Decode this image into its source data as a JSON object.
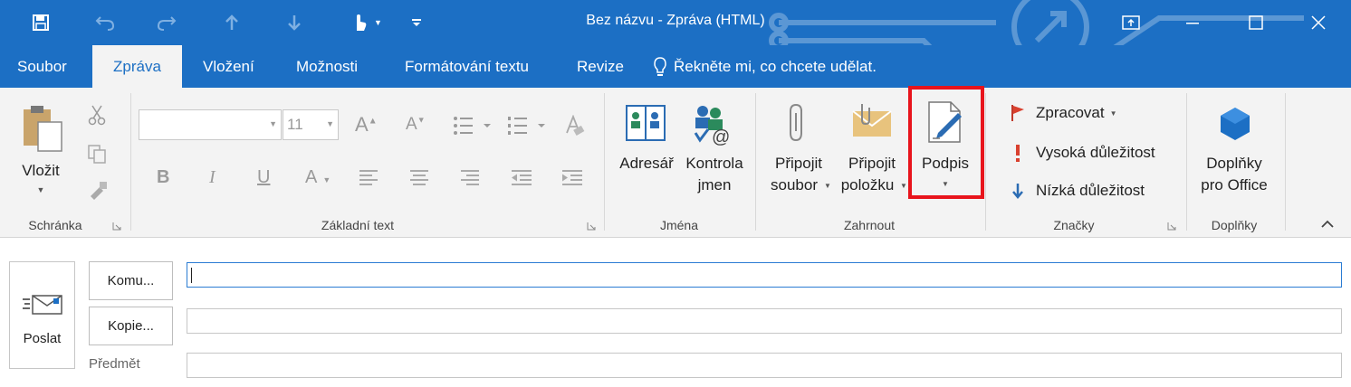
{
  "window": {
    "title": "Bez názvu  -  Zpráva (HTML)"
  },
  "tabs": [
    "Soubor",
    "Zpráva",
    "Vložení",
    "Možnosti",
    "Formátování textu",
    "Revize"
  ],
  "active_tab": "Zpráva",
  "tell_me": "Řekněte mi, co chcete udělat.",
  "ribbon": {
    "clipboard": {
      "paste_label": "Vložit",
      "group_label": "Schránka"
    },
    "basic_text": {
      "font_size": "11",
      "group_label": "Základní text"
    },
    "names": {
      "address_book": "Adresář",
      "check_names_1": "Kontrola",
      "check_names_2": "jmen",
      "group_label": "Jména"
    },
    "include": {
      "attach_file_1": "Připojit",
      "attach_file_2": "soubor",
      "attach_item_1": "Připojit",
      "attach_item_2": "položku",
      "signature": "Podpis",
      "group_label": "Zahrnout"
    },
    "tags": {
      "follow_up": "Zpracovat",
      "high_importance": "Vysoká důležitost",
      "low_importance": "Nízká důležitost",
      "group_label": "Značky"
    },
    "addins": {
      "office_addins_1": "Doplňky",
      "office_addins_2": "pro Office",
      "group_label": "Doplňky"
    }
  },
  "compose": {
    "send": "Poslat",
    "to": "Komu...",
    "cc": "Kopie...",
    "subject_label": "Předmět",
    "to_value": "",
    "cc_value": "",
    "subject_value": ""
  },
  "colors": {
    "accent": "#1c6fc4",
    "highlight": "#e8141c"
  }
}
